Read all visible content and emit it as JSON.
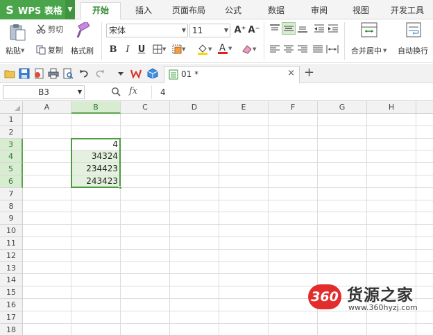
{
  "app": {
    "logo": "S",
    "name": "WPS 表格",
    "dropdown": "▼"
  },
  "tabs": [
    {
      "label": "开始",
      "active": true
    },
    {
      "label": "插入"
    },
    {
      "label": "页面布局"
    },
    {
      "label": "公式"
    },
    {
      "label": "数据"
    },
    {
      "label": "审阅"
    },
    {
      "label": "视图"
    },
    {
      "label": "开发工具"
    }
  ],
  "ribbon": {
    "paste_label": "粘贴",
    "cut_label": "剪切",
    "copy_label": "复制",
    "format_painter_label": "格式刷",
    "font_name": "宋体",
    "font_size": "11",
    "grow_font": "A⁺",
    "shrink_font": "A⁻",
    "bold": "B",
    "italic": "I",
    "underline": "U",
    "merge_label": "合并居中",
    "wrap_label": "自动换行"
  },
  "document": {
    "tab_name": "01 *",
    "close": "×",
    "add": "+"
  },
  "formula_bar": {
    "name_box": "B3",
    "fx": "fx",
    "value": "4"
  },
  "sheet": {
    "columns": [
      "A",
      "B",
      "C",
      "D",
      "E",
      "F",
      "G",
      "H"
    ],
    "rows": [
      "1",
      "2",
      "3",
      "4",
      "5",
      "6",
      "7",
      "8",
      "9",
      "10",
      "11",
      "12",
      "13",
      "14",
      "15",
      "16",
      "17",
      "18"
    ],
    "selected_column": "B",
    "selected_rows": [
      "3",
      "4",
      "5",
      "6"
    ],
    "cells": [
      {
        "ref": "B3",
        "value": "4"
      },
      {
        "ref": "B4",
        "value": "34324"
      },
      {
        "ref": "B5",
        "value": "234423"
      },
      {
        "ref": "B6",
        "value": "243423"
      }
    ]
  },
  "watermark": {
    "badge": "360",
    "title": "货源之家",
    "url": "www.360hyzj.com"
  },
  "colors": {
    "accent": "#4aa54a",
    "selection": "#4a9a3e",
    "selection_fill": "#e4f1de",
    "watermark_red": "#e32c2c"
  }
}
